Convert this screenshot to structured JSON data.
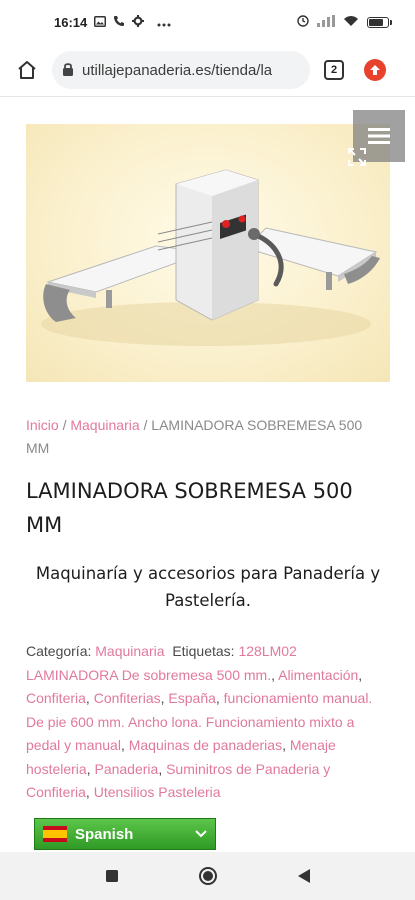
{
  "status_bar": {
    "time": "16:14",
    "left_icons": [
      "image-icon",
      "wifi-calling-icon",
      "settings-icon",
      "more-dots-icon"
    ],
    "right_icons": [
      "alarm-icon",
      "signal-icon",
      "wifi-icon",
      "battery-icon"
    ],
    "battery_level": 0.8
  },
  "browser": {
    "url": "utillajepanaderia.es/tienda/la",
    "tab_count": "2"
  },
  "product": {
    "image_alt": "laminadora-sobremesa-machine",
    "breadcrumb": {
      "home": "Inicio",
      "sep1": " / ",
      "category": "Maquinaria",
      "sep2": " / ",
      "current": "LAMINADORA SOBREMESA 500 MM"
    },
    "title": "LAMINADORA SOBREMESA 500 MM",
    "tagline": "Maquinaría y accesorios para Panadería y Pastelería."
  },
  "meta": {
    "category_label": "Categoría:",
    "category_value": "Maquinaria",
    "tags_label": "Etiquetas:",
    "tags": [
      "128LM02 LAMINADORA De sobremesa 500 mm.",
      "Alimentación",
      "Confiteria",
      "Confiterias",
      "España",
      "funcionamiento manual. De pie 600 mm. Ancho lona. Funcionamiento mixto a pedal y manual",
      "Maquinas de panaderias",
      "Menaje hosteleria",
      "Panaderia",
      "Suminitros de Panaderia y Confiteria",
      "Utensilios Pasteleria"
    ],
    "separator": ", "
  },
  "language": {
    "selected": "Spanish"
  },
  "colors": {
    "link": "#e0799e",
    "accent_green": "#3aa82f",
    "update_red": "#e8412c"
  }
}
